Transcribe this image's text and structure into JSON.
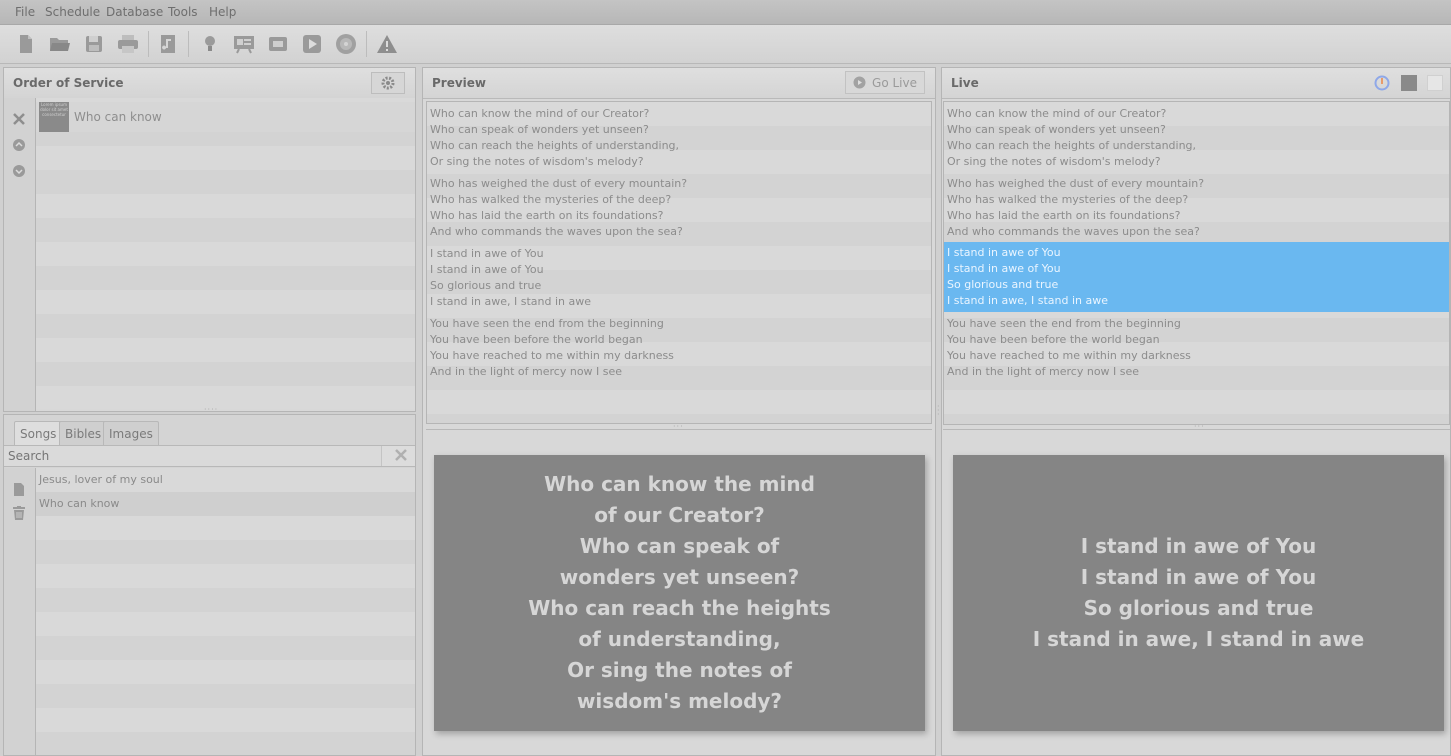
{
  "menu": [
    "File",
    "Schedule",
    "Database",
    "Tools",
    "Help"
  ],
  "toolbar": {
    "icons": [
      "new-schedule-icon",
      "open-schedule-icon",
      "save-schedule-icon",
      "print-icon",
      "add-song-icon",
      "notice-icon",
      "presentation-icon",
      "video-icon",
      "play-icon",
      "dvd-icon",
      "warning-icon"
    ]
  },
  "order": {
    "title": "Order of Service",
    "items": [
      {
        "thumb": "Lorem ipsum dolor sit amet consectetur",
        "label": "Who can know"
      }
    ]
  },
  "library": {
    "tabs": [
      "Songs",
      "Bibles",
      "Images"
    ],
    "search_placeholder": "Search",
    "songs": [
      "Jesus, lover of my soul",
      "Who can know"
    ]
  },
  "preview": {
    "title": "Preview",
    "go_live_label": "Go Live",
    "verses": [
      [
        "Who can know the mind of our Creator?",
        "Who can speak of wonders yet unseen?",
        "Who can reach the heights of understanding,",
        "Or sing the notes of wisdom's melody?"
      ],
      [
        "Who has weighed the dust of every mountain?",
        "Who has walked the mysteries of the deep?",
        "Who has laid the earth on its foundations?",
        "And who commands the waves upon the sea?"
      ],
      [
        "I stand in awe of You",
        "I stand in awe of You",
        "So glorious and true",
        "I stand in awe, I stand in awe"
      ],
      [
        "You have seen the end from the beginning",
        "You have been before the world began",
        "You have reached to me within my darkness",
        "And in the light of mercy now I see"
      ]
    ],
    "screen_text": "Who can know the mind\nof our Creator?\nWho can speak of\nwonders yet unseen?\nWho can reach the heights\nof understanding,\nOr sing the notes of\nwisdom's melody?"
  },
  "live": {
    "title": "Live",
    "selected_index": 2,
    "verses": [
      [
        "Who can know the mind of our Creator?",
        "Who can speak of wonders yet unseen?",
        "Who can reach the heights of understanding,",
        "Or sing the notes of wisdom's melody?"
      ],
      [
        "Who has weighed the dust of every mountain?",
        "Who has walked the mysteries of the deep?",
        "Who has laid the earth on its foundations?",
        "And who commands the waves upon the sea?"
      ],
      [
        "I stand in awe of You",
        "I stand in awe of You",
        "So glorious and true",
        "I stand in awe, I stand in awe"
      ],
      [
        "You have seen the end from the beginning",
        "You have been before the world began",
        "You have reached to me within my darkness",
        "And in the light of mercy now I see"
      ]
    ],
    "screen_text": "I stand in awe of You\nI stand in awe of You\nSo glorious and true\nI stand in awe, I stand in awe"
  },
  "colors": {
    "highlight": "#6ab8f0",
    "screen": "#858585"
  }
}
